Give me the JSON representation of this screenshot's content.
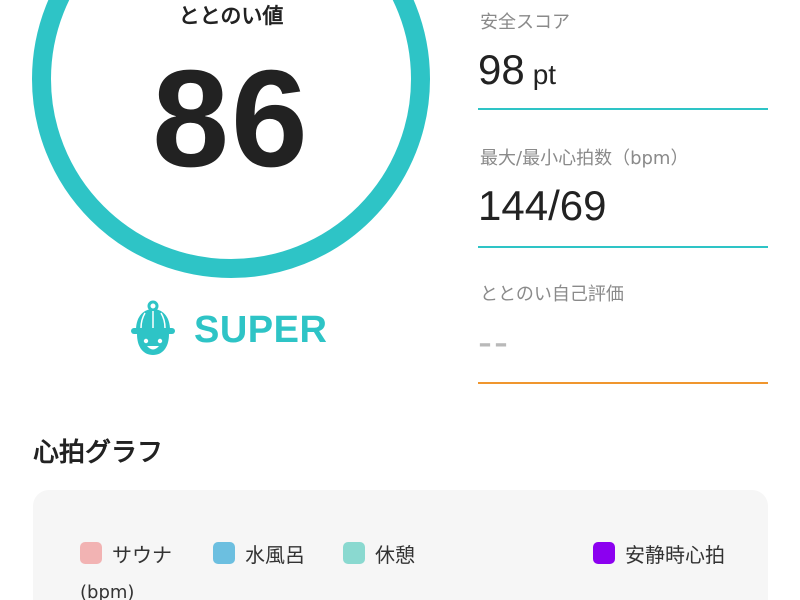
{
  "score": {
    "label": "ととのい値",
    "value": "86",
    "ring_color": "#2ec4c6"
  },
  "rank": {
    "icon": "sauna-hat-face-icon",
    "label": "SUPER",
    "color": "#2ec4c6"
  },
  "metrics": {
    "safety": {
      "label": "安全スコア",
      "value": "98",
      "unit": "pt"
    },
    "heart_rate": {
      "label": "最大/最小心拍数（bpm）",
      "value": "144/69"
    },
    "self_eval": {
      "label": "ととのい自己評価",
      "value": "--"
    }
  },
  "graph": {
    "title": "心拍グラフ",
    "legend": [
      {
        "label": "サウナ",
        "color": "#f2b3b3"
      },
      {
        "label": "水風呂",
        "color": "#6cbfe0"
      },
      {
        "label": "休憩",
        "color": "#8ad9d0"
      },
      {
        "label": "安静時心拍",
        "color": "#8c00f0"
      }
    ],
    "y_unit": "(bpm)"
  },
  "colors": {
    "accent": "#2ec4c6",
    "rule_default": "#2ec4c6",
    "rule_empty": "#f0962e"
  }
}
